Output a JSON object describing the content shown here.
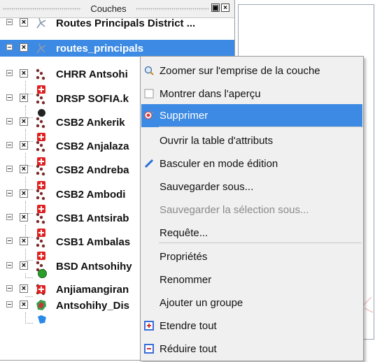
{
  "panel": {
    "title": "Couches",
    "float_button": "▣",
    "close_button": "×",
    "layers": [
      {
        "label": "Routes Principals District ...",
        "icon": "line-layer-icon",
        "checked": "×"
      },
      {
        "label": "routes_principals",
        "icon": "line-layer-icon",
        "checked": "×",
        "selected": true
      },
      {
        "label": "CHRR Antsohi",
        "icon": "point-layer-icon",
        "checked": "×",
        "symbol": "red-plus-icon"
      },
      {
        "label": "DRSP SOFIA.k",
        "icon": "point-layer-icon",
        "checked": "×",
        "symbol": "black-dot-icon"
      },
      {
        "label": "CSB2 Ankerik",
        "icon": "point-layer-icon",
        "checked": "×",
        "symbol": "red-plus-icon"
      },
      {
        "label": "CSB2 Anjalaza",
        "icon": "point-layer-icon",
        "checked": "×",
        "symbol": "red-plus-icon"
      },
      {
        "label": "CSB2 Andreba",
        "icon": "point-layer-icon",
        "checked": "×",
        "symbol": "red-plus-icon"
      },
      {
        "label": "CSB2 Ambodi",
        "icon": "point-layer-icon",
        "checked": "×",
        "symbol": "red-plus-icon"
      },
      {
        "label": "CSB1 Antsirab",
        "icon": "point-layer-icon",
        "checked": "×",
        "symbol": "red-plus-icon"
      },
      {
        "label": "CSB1 Ambalas",
        "icon": "point-layer-icon",
        "checked": "×",
        "symbol": "red-plus-icon"
      },
      {
        "label": "BSD Antsohihy",
        "icon": "point-layer-icon",
        "checked": "×",
        "symbol": "green-dot-icon"
      },
      {
        "label": "Anjiamangiran",
        "icon": "point-layer-icon",
        "checked": "×",
        "symbol": "red-plus-icon"
      },
      {
        "label": "Antsohihy_Dis",
        "icon": "polygon-layer-icon",
        "checked": "×",
        "symbol": "blue-polygon-icon"
      }
    ]
  },
  "context_menu": {
    "items": [
      {
        "label": "Zoomer sur l'emprise de la couche",
        "icon": "zoom-extent-icon"
      },
      {
        "label": "Montrer dans l'aperçu",
        "icon": "checkbox-icon"
      },
      {
        "label": "Supprimer",
        "icon": "remove-layer-icon",
        "highlighted": true
      },
      {
        "label": "Ouvrir la table d'attributs",
        "icon": ""
      },
      {
        "label": "Basculer en mode édition",
        "icon": "pencil-icon"
      },
      {
        "label": "Sauvegarder sous...",
        "icon": ""
      },
      {
        "label": "Sauvegarder la sélection sous...",
        "icon": "",
        "disabled": true
      },
      {
        "label": "Requête...",
        "icon": ""
      },
      {
        "label": "Propriétés",
        "icon": ""
      },
      {
        "label": "Renommer",
        "icon": ""
      },
      {
        "label": "Ajouter un groupe",
        "icon": ""
      },
      {
        "label": "Etendre tout",
        "icon": "expand-all-icon"
      },
      {
        "label": "Réduire tout",
        "icon": "collapse-all-icon"
      }
    ]
  },
  "colors": {
    "selection": "#3c8ae3",
    "menu_background": "#f0f0f0",
    "symbol_red": "#e02020",
    "symbol_black": "#222222",
    "symbol_green": "#2aa02a",
    "symbol_blue": "#2a8ae8"
  }
}
